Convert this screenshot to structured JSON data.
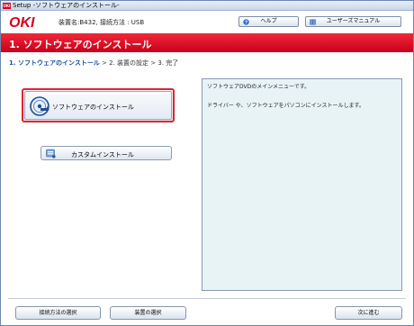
{
  "window": {
    "title": "Setup -ソフトウェアのインストール-"
  },
  "header": {
    "logo_text": "OKI",
    "printer_info": "装置名:B432, 接続方法 : USB",
    "help_label": "ヘルプ",
    "manual_label": "ユーザーズマニュアル"
  },
  "step_title": "1. ソフトウェアのインストール",
  "breadcrumb": {
    "step1": "1. ソフトウェアのインストール",
    "sep1": " > ",
    "step2": "2. 装置の設定",
    "sep2": " > ",
    "step3": "3. 完了"
  },
  "buttons": {
    "install_software": "ソフトウェアのインストール",
    "custom_install": "カスタムインストール",
    "select_connection": "接続方法の選択",
    "select_device": "装置の選択",
    "next": "次に進む"
  },
  "description": {
    "line1": "ソフトウェアDVDのメインメニューです。",
    "line2": "ドライバー や、ソフトウェアをパソコンにインストールします。"
  },
  "colors": {
    "brand_red": "#d8001c",
    "step_bar": "#e0102a",
    "accent_blue": "#1a4fa0",
    "desc_bg": "#e8f3f6"
  },
  "icons": {
    "install": "disc-install-icon",
    "custom": "custom-install-icon",
    "help": "help-icon",
    "manual": "manual-book-icon"
  }
}
